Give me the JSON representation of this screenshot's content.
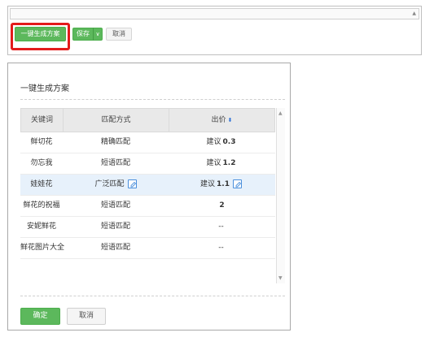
{
  "toolbar": {
    "generate_label": "一键生成方案",
    "save_label": "保存",
    "save_caret": "∨",
    "cancel_label": "取消"
  },
  "dialog": {
    "title": "一键生成方案",
    "columns": {
      "keyword": "关键词",
      "match": "匹配方式",
      "bid": "出价"
    },
    "rows": [
      {
        "keyword": "鲜切花",
        "match": "精确匹配",
        "bid_prefix": "建议",
        "bid_value": "0.3",
        "editable": false
      },
      {
        "keyword": "勿忘我",
        "match": "短语匹配",
        "bid_prefix": "建议",
        "bid_value": "1.2",
        "editable": false
      },
      {
        "keyword": "娃娃花",
        "match": "广泛匹配",
        "bid_prefix": "建议",
        "bid_value": "1.1",
        "editable": true
      },
      {
        "keyword": "鲜花的祝福",
        "match": "短语匹配",
        "bid_prefix": "",
        "bid_value": "2",
        "editable": false
      },
      {
        "keyword": "安妮鲜花",
        "match": "短语匹配",
        "bid_prefix": "",
        "bid_value": "--",
        "editable": false
      },
      {
        "keyword": "鲜花图片大全",
        "match": "短语匹配",
        "bid_prefix": "",
        "bid_value": "--",
        "editable": false
      }
    ],
    "confirm_label": "确定",
    "cancel_label": "取消"
  },
  "colors": {
    "primary_green": "#5cb85c",
    "highlight_red": "#e31b1b",
    "row_highlight": "#e7f1fb",
    "edit_blue": "#4a8fdc"
  },
  "icons": {
    "sort": "sort-icon",
    "edit": "edit-icon",
    "dropdown": "chevron-down-icon"
  }
}
